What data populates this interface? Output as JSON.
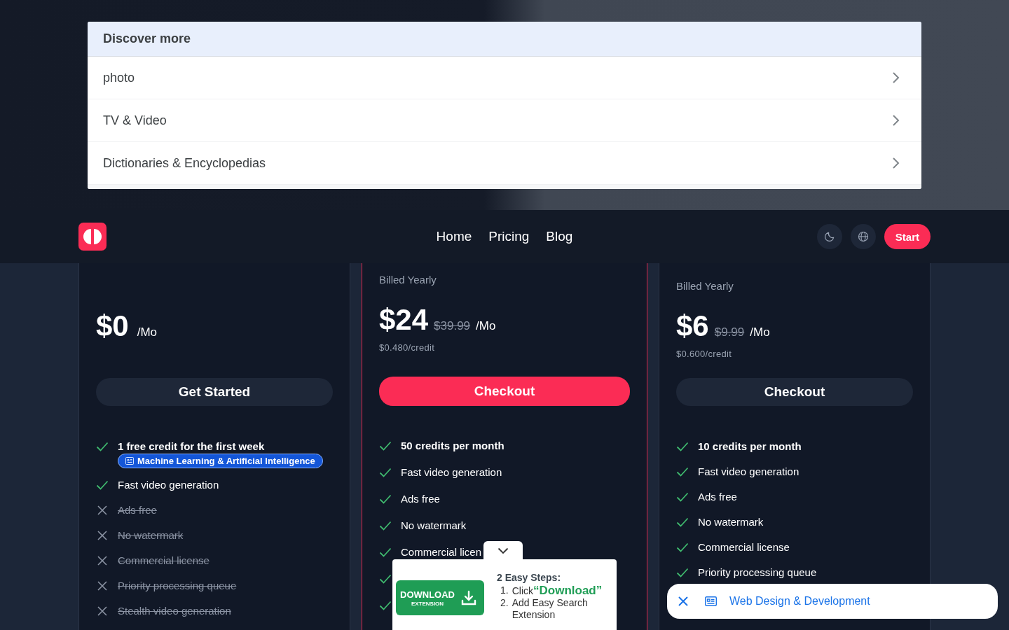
{
  "discover": {
    "title": "Discover more",
    "items": [
      {
        "label": "photo"
      },
      {
        "label": "TV & Video"
      },
      {
        "label": "Dictionaries & Encyclopedias"
      }
    ]
  },
  "header": {
    "nav": [
      {
        "label": "Home"
      },
      {
        "label": "Pricing"
      },
      {
        "label": "Blog"
      }
    ],
    "start": "Start"
  },
  "plans": [
    {
      "featured": false,
      "price": "$0",
      "per": "/Mo",
      "button": "Get Started",
      "features": [
        {
          "kind": "headline",
          "included": true,
          "text": "1 free credit for the first week",
          "tag": "Machine Learning & Artificial Intelligence"
        },
        {
          "kind": "regular",
          "included": true,
          "text": "Fast video generation"
        },
        {
          "kind": "regular",
          "included": false,
          "text": "Ads free"
        },
        {
          "kind": "regular",
          "included": false,
          "text": "No watermark"
        },
        {
          "kind": "regular",
          "included": false,
          "text": "Commercial license"
        },
        {
          "kind": "regular",
          "included": false,
          "text": "Priority processing queue"
        },
        {
          "kind": "regular",
          "included": false,
          "text": "Stealth video generation"
        }
      ]
    },
    {
      "featured": true,
      "billing": "Billed Yearly",
      "price": "$24",
      "old_price": "$39.99",
      "per": "/Mo",
      "credit_price": "$0.480/credit",
      "button": "Checkout",
      "features": [
        {
          "kind": "headline",
          "included": true,
          "text": "50 credits per month"
        },
        {
          "kind": "regular",
          "included": true,
          "text": "Fast video generation"
        },
        {
          "kind": "regular",
          "included": true,
          "text": "Ads free"
        },
        {
          "kind": "regular",
          "included": true,
          "text": "No watermark"
        },
        {
          "kind": "regular",
          "included": true,
          "text": "Commercial licen"
        },
        {
          "kind": "regular",
          "included": true
        },
        {
          "kind": "regular",
          "included": true
        }
      ]
    },
    {
      "featured": false,
      "billing": "Billed Yearly",
      "price": "$6",
      "old_price": "$9.99",
      "per": "/Mo",
      "credit_price": "$0.600/credit",
      "button": "Checkout",
      "features": [
        {
          "kind": "headline",
          "included": true,
          "text": "10 credits per month"
        },
        {
          "kind": "regular",
          "included": true,
          "text": "Fast video generation"
        },
        {
          "kind": "regular",
          "included": true,
          "text": "Ads free"
        },
        {
          "kind": "regular",
          "included": true,
          "text": "No watermark"
        },
        {
          "kind": "regular",
          "included": true,
          "text": "Commercial license"
        },
        {
          "kind": "regular",
          "included": true,
          "text": "Priority processing queue"
        }
      ]
    }
  ],
  "extension_popup": {
    "button": "DOWNLOAD",
    "button_sub": "EXTENSION",
    "steps_title": "2 Easy Steps:",
    "steps": [
      {
        "number": "1.",
        "text": "Click",
        "highlight": "“Download”"
      },
      {
        "number": "2.",
        "text": "Add Easy Search Extension"
      }
    ]
  },
  "toast": {
    "label": "Web Design & Development"
  }
}
